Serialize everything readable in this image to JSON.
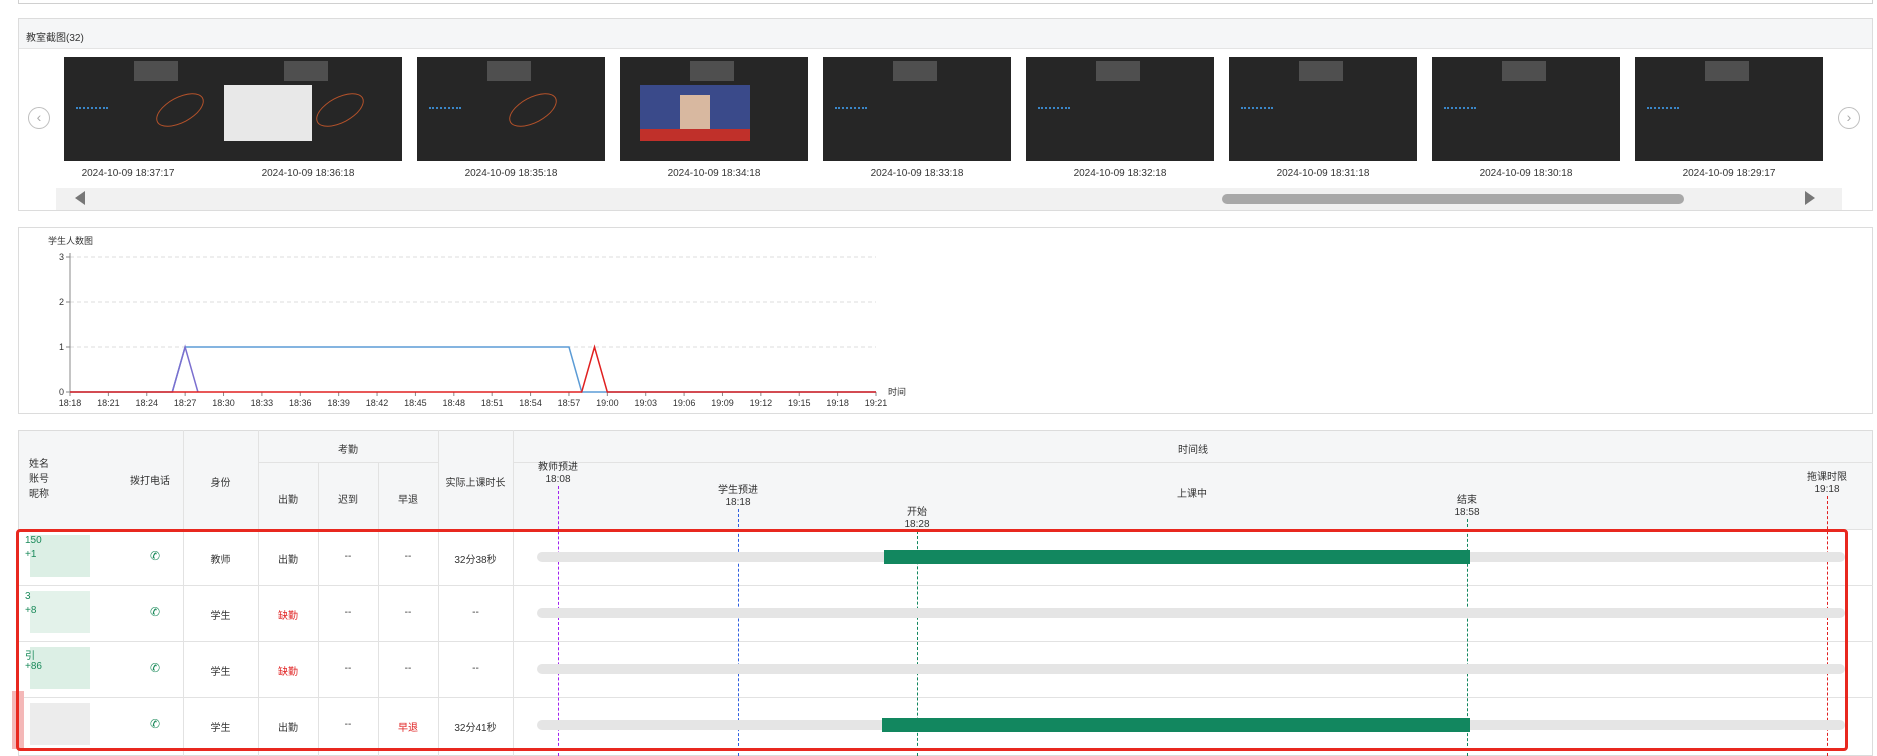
{
  "screenshots": {
    "title": "教室截图(32)",
    "times": [
      "2024-10-09 18:37:17",
      "2024-10-09 18:36:18",
      "2024-10-09 18:35:18",
      "2024-10-09 18:34:18",
      "2024-10-09 18:33:18",
      "2024-10-09 18:32:18",
      "2024-10-09 18:31:18",
      "2024-10-09 18:30:18",
      "2024-10-09 18:29:17"
    ],
    "prev_icon": "chevron-left-icon",
    "next_icon": "chevron-right-icon"
  },
  "chart_data": {
    "type": "line",
    "ylabel": "学生人数图",
    "xlabel": "时间",
    "ylim": [
      0,
      3
    ],
    "yticks": [
      "0",
      "1",
      "2",
      "3"
    ],
    "categories": [
      "18:18",
      "18:21",
      "18:24",
      "18:27",
      "18:30",
      "18:33",
      "18:36",
      "18:39",
      "18:42",
      "18:45",
      "18:48",
      "18:51",
      "18:54",
      "18:57",
      "19:00",
      "19:03",
      "19:06",
      "19:09",
      "19:12",
      "19:15",
      "19:18",
      "19:21"
    ],
    "series": [
      {
        "color": "#5b9bd5",
        "points": [
          [
            "18:18",
            0
          ],
          [
            "18:26",
            0
          ],
          [
            "18:27",
            1
          ],
          [
            "18:57",
            1
          ],
          [
            "18:58",
            0
          ],
          [
            "19:21",
            0
          ]
        ]
      },
      {
        "color": "#7b6fcf",
        "points": [
          [
            "18:26",
            0
          ],
          [
            "18:27",
            1
          ],
          [
            "18:28",
            0
          ]
        ]
      },
      {
        "color": "#e02020",
        "points": [
          [
            "18:18",
            0
          ],
          [
            "18:58",
            0
          ],
          [
            "18:59",
            1
          ],
          [
            "19:00",
            0
          ],
          [
            "19:21",
            0
          ]
        ]
      }
    ],
    "grid": true
  },
  "table": {
    "headers": {
      "name_lines": [
        "姓名",
        "账号",
        "昵称"
      ],
      "call": "拨打电话",
      "role": "身份",
      "attendance": "考勤",
      "present": "出勤",
      "late": "迟到",
      "early": "早退",
      "duration": "实际上课时长",
      "timeline": "时间线"
    },
    "timeline_marks": [
      {
        "label": "教师预进",
        "time": "18:08",
        "color": "#a020f0"
      },
      {
        "label": "学生预进",
        "time": "18:18",
        "color": "#3060e0"
      },
      {
        "label": "开始",
        "time": "18:28",
        "color": "#12875f"
      },
      {
        "label": "上课中",
        "time": "",
        "color": ""
      },
      {
        "label": "结束",
        "time": "18:58",
        "color": "#12875f"
      },
      {
        "label": "拖课时限",
        "time": "19:18",
        "color": "#e02020"
      }
    ],
    "rows": [
      {
        "name": "150",
        "phone": "+1",
        "role": "教师",
        "present": "出勤",
        "late": "--",
        "early": "--",
        "duration": "32分38秒",
        "present_red": false,
        "early_red": false
      },
      {
        "name": "3",
        "phone": "+8",
        "role": "学生",
        "present": "缺勤",
        "late": "--",
        "early": "--",
        "duration": "--",
        "present_red": true,
        "early_red": false
      },
      {
        "name": "引",
        "phone": "+86",
        "role": "学生",
        "present": "缺勤",
        "late": "--",
        "early": "--",
        "duration": "--",
        "present_red": true,
        "early_red": false
      },
      {
        "name": "",
        "phone": "",
        "role": "学生",
        "present": "出勤",
        "late": "--",
        "early": "早退",
        "duration": "32分41秒",
        "present_red": false,
        "early_red": true
      }
    ],
    "phone_icon": "phone-icon"
  }
}
